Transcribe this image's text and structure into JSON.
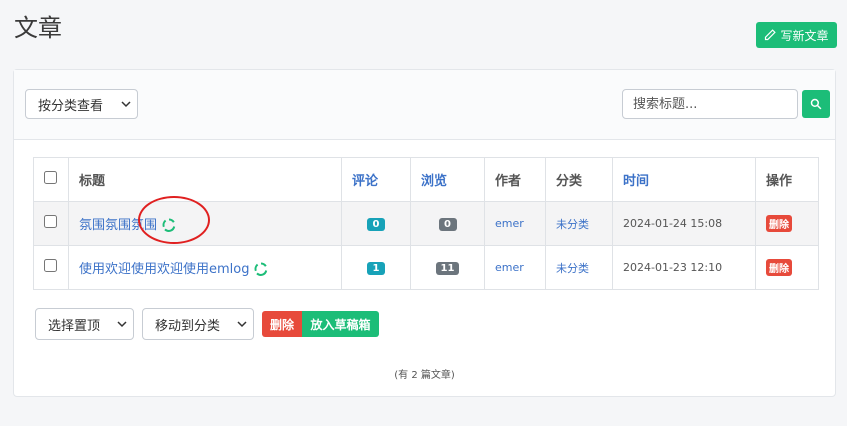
{
  "page": {
    "title": "文章"
  },
  "toolbar": {
    "new_post_label": "写新文章"
  },
  "filter": {
    "category_select": "按分类查看",
    "search_placeholder": "搜索标题..."
  },
  "table": {
    "headers": [
      "标题",
      "评论",
      "浏览",
      "作者",
      "分类",
      "时间",
      "操作"
    ],
    "rows": [
      {
        "title": "氛围氛围氛围",
        "comments": "0",
        "views": "0",
        "author": "emer",
        "category": "未分类",
        "time": "2024-01-24 15:08",
        "action": "删除"
      },
      {
        "title": "使用欢迎使用欢迎使用emlog",
        "comments": "1",
        "views": "11",
        "author": "emer",
        "category": "未分类",
        "time": "2024-01-23 12:10",
        "action": "删除"
      }
    ]
  },
  "bulk": {
    "top_select": "选择置顶",
    "move_select": "移动到分类",
    "delete_label": "删除",
    "draft_label": "放入草稿箱"
  },
  "footer": {
    "count_text": "(有 2 篇文章)"
  },
  "colors": {
    "accent": "#1cbd78",
    "danger": "#e74a3b",
    "link": "#3c72c8",
    "badge_teal": "#17a2b8",
    "badge_gray": "#6c757d",
    "annotation": "#e02020"
  },
  "icons": {
    "new_post": "pencil-icon",
    "search": "search-icon",
    "status": "sync-icon",
    "dropdown": "chevron-down-icon"
  }
}
